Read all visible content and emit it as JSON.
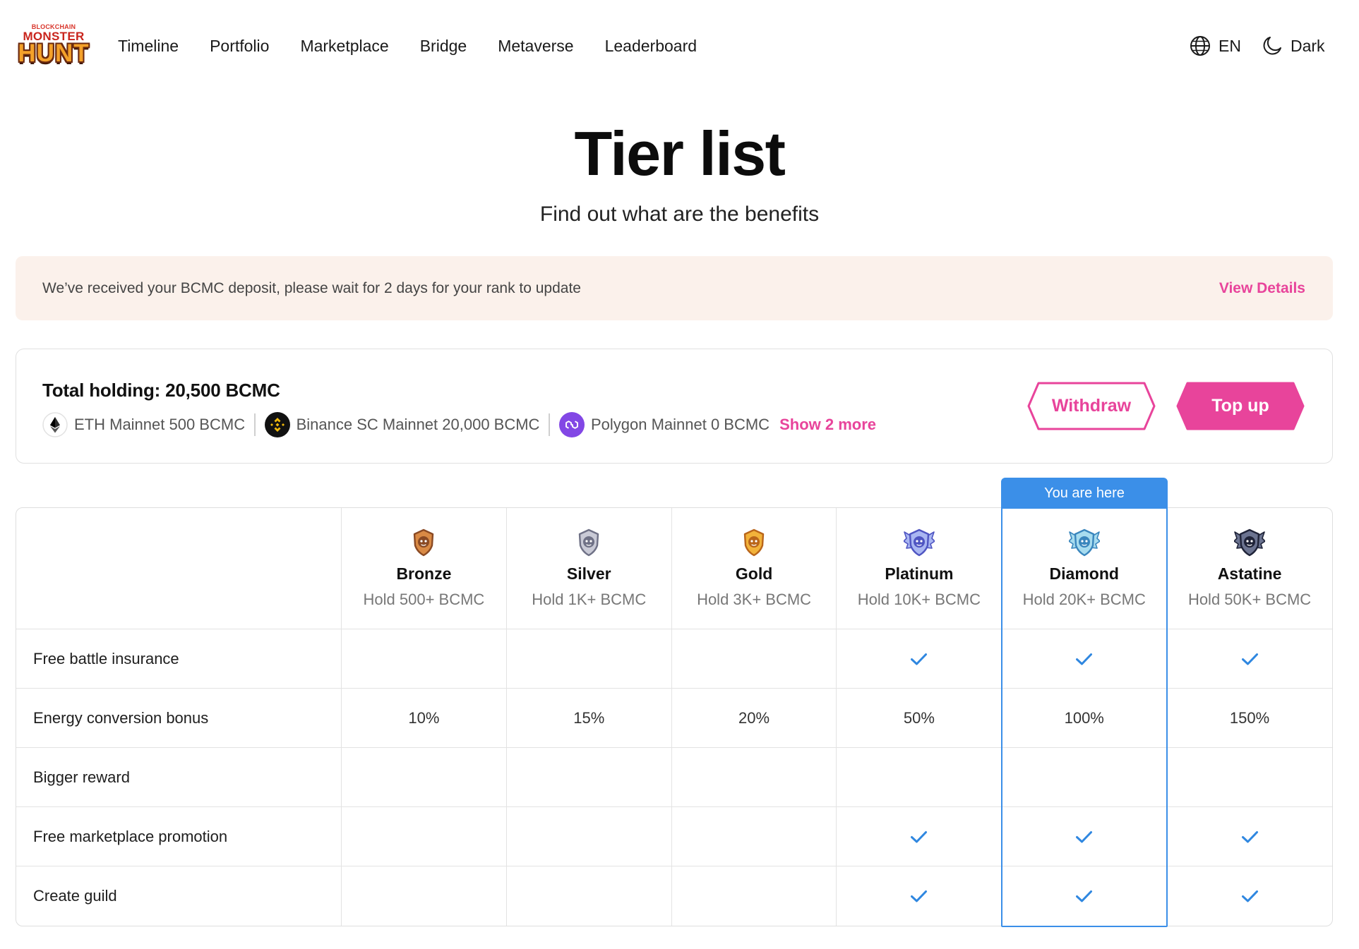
{
  "nav": {
    "logo": {
      "line1": "BLOCKCHAIN",
      "line2": "MONSTER",
      "line3": "HUNT"
    },
    "links": [
      "Timeline",
      "Portfolio",
      "Marketplace",
      "Bridge",
      "Metaverse",
      "Leaderboard"
    ],
    "language": {
      "icon": "globe-icon",
      "label": "EN"
    },
    "theme": {
      "icon": "moon-icon",
      "label": "Dark"
    }
  },
  "hero": {
    "title": "Tier list",
    "subtitle": "Find out what are the benefits"
  },
  "notice": {
    "message": "We’ve received your BCMC deposit, please wait for 2 days for your rank to update",
    "action": "View Details"
  },
  "holding": {
    "title": "Total holding: 20,500 BCMC",
    "chains": [
      {
        "icon": "eth-icon",
        "label": "ETH Mainnet 500 BCMC"
      },
      {
        "icon": "binance-icon",
        "label": "Binance SC Mainnet 20,000 BCMC"
      },
      {
        "icon": "polygon-icon",
        "label": "Polygon Mainnet 0 BCMC"
      }
    ],
    "show_more": "Show 2 more",
    "withdraw": "Withdraw",
    "top_up": "Top up"
  },
  "tiers": {
    "current_badge": "You are here",
    "current_index": 4,
    "columns": [
      {
        "name": "Bronze",
        "requirement": "Hold 500+ BCMC",
        "icon": "bronze-badge-icon",
        "color_dark": "#8a4a24",
        "color_light": "#d98a45"
      },
      {
        "name": "Silver",
        "requirement": "Hold 1K+ BCMC",
        "icon": "silver-badge-icon",
        "color_dark": "#6f7186",
        "color_light": "#c9cad6"
      },
      {
        "name": "Gold",
        "requirement": "Hold 3K+ BCMC",
        "icon": "gold-badge-icon",
        "color_dark": "#b9651a",
        "color_light": "#f2b23a"
      },
      {
        "name": "Platinum",
        "requirement": "Hold 10K+ BCMC",
        "icon": "platinum-badge-icon",
        "color_dark": "#4f55c2",
        "color_light": "#a9b6f2"
      },
      {
        "name": "Diamond",
        "requirement": "Hold 20K+ BCMC",
        "icon": "diamond-badge-icon",
        "color_dark": "#3a86bd",
        "color_light": "#a7dcef"
      },
      {
        "name": "Astatine",
        "requirement": "Hold 50K+ BCMC",
        "icon": "astatine-badge-icon",
        "color_dark": "#1f2338",
        "color_light": "#6b7390"
      }
    ],
    "rows": [
      {
        "label": "Free battle insurance",
        "values": [
          false,
          false,
          false,
          true,
          true,
          true
        ]
      },
      {
        "label": "Energy conversion bonus",
        "values": [
          "10%",
          "15%",
          "20%",
          "50%",
          "100%",
          "150%"
        ]
      },
      {
        "label": "Bigger reward",
        "values": [
          false,
          false,
          false,
          false,
          false,
          false
        ]
      },
      {
        "label": "Free marketplace promotion",
        "values": [
          false,
          false,
          false,
          true,
          true,
          true
        ]
      },
      {
        "label": "Create guild",
        "values": [
          false,
          false,
          false,
          true,
          true,
          true
        ]
      }
    ]
  },
  "colors": {
    "accent_pink": "#e8449b",
    "highlight_blue": "#3b8fe8",
    "check_blue": "#2f87e0",
    "notice_background": "#fbf1eb"
  }
}
